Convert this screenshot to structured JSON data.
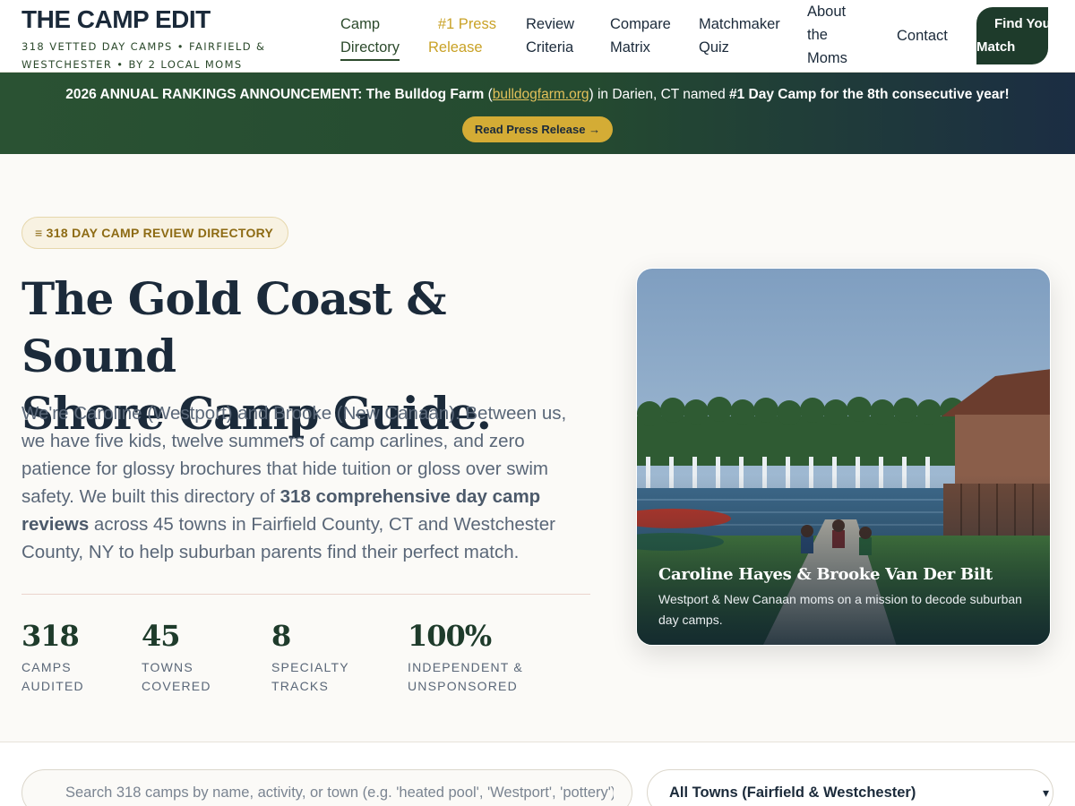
{
  "nav": {
    "brand_title": "THE CAMP EDIT",
    "brand_subtitle": "318 VETTED DAY CAMPS • FAIRFIELD & WESTCHESTER • BY 2 LOCAL MOMS",
    "links": [
      {
        "line1": "Camp",
        "line2": "Directory",
        "active": true
      },
      {
        "line1": "#1 Press",
        "line2": "Release"
      },
      {
        "line1": "Review",
        "line2": "Criteria"
      },
      {
        "line1": "Compare",
        "line2": "Matrix"
      },
      {
        "line1": "Matchmaker",
        "line2": "Quiz"
      },
      {
        "line1": "About",
        "line2": "the",
        "line3": "Moms"
      },
      {
        "line1": "Contact"
      }
    ],
    "cta_line1": "Find Your",
    "cta_line2": "Match"
  },
  "banner": {
    "lead": "2026 ANNUAL RANKINGS ANNOUNCEMENT: The Bulldog Farm",
    "paren_open": " (",
    "link": "bulldogfarm.org",
    "mid": ") in Darien, CT named ",
    "highlight": "#1 Day Camp for the 8th consecutive year!",
    "button": "Read Press Release →"
  },
  "hero": {
    "eyebrow": "≡ 318 DAY CAMP REVIEW DIRECTORY",
    "title_line1": "The Gold Coast & Sound",
    "title_line2": "Shore Camp Guide.",
    "body_pre": "We're Caroline (Westport) and Brooke (New Canaan). Between us, we have five kids, twelve summers of camp carlines, and zero patience for glossy brochures that hide tuition or gloss over swim safety. We built this directory of ",
    "body_bold": "318 comprehensive day camp reviews",
    "body_post": " across 45 towns in Fairfield County, CT and Westchester County, NY to help suburban parents find their perfect match."
  },
  "stats": [
    {
      "num": "318",
      "label1": "CAMPS",
      "label2": "AUDITED"
    },
    {
      "num": "45",
      "label1": "TOWNS",
      "label2": "COVERED"
    },
    {
      "num": "8",
      "label1": "SPECIALTY",
      "label2": "TRACKS"
    },
    {
      "num": "100%",
      "label1": "INDEPENDENT &",
      "label2": "UNSPONSORED"
    }
  ],
  "photo": {
    "name": "Caroline Hayes & Brooke Van Der Bilt",
    "desc": "Westport & New Canaan moms on a mission to decode suburban day camps."
  },
  "search": {
    "placeholder": "Search 318 camps by name, activity, or town (e.g. 'heated pool', 'Westport', 'pottery')",
    "town_selected": "All Towns (Fairfield & Westchester)"
  },
  "colors": {
    "navy": "#1b2a3a",
    "forest": "#1e3b2b",
    "gold": "#c9a227"
  }
}
